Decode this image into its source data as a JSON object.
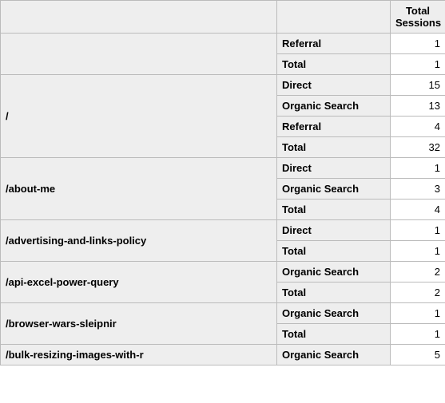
{
  "header": {
    "blank1": "",
    "blank2": "",
    "sessions_label": "Total Sessions"
  },
  "groups": [
    {
      "page": "",
      "rows": [
        {
          "channel": "Referral",
          "sessions": "1"
        },
        {
          "channel": "Total",
          "sessions": "1"
        }
      ]
    },
    {
      "page": "/",
      "rows": [
        {
          "channel": "Direct",
          "sessions": "15"
        },
        {
          "channel": "Organic Search",
          "sessions": "13"
        },
        {
          "channel": "Referral",
          "sessions": "4"
        },
        {
          "channel": "Total",
          "sessions": "32"
        }
      ]
    },
    {
      "page": "/about-me",
      "rows": [
        {
          "channel": "Direct",
          "sessions": "1"
        },
        {
          "channel": "Organic Search",
          "sessions": "3"
        },
        {
          "channel": "Total",
          "sessions": "4"
        }
      ]
    },
    {
      "page": "/advertising-and-links-policy",
      "rows": [
        {
          "channel": "Direct",
          "sessions": "1"
        },
        {
          "channel": "Total",
          "sessions": "1"
        }
      ]
    },
    {
      "page": "/api-excel-power-query",
      "rows": [
        {
          "channel": "Organic Search",
          "sessions": "2"
        },
        {
          "channel": "Total",
          "sessions": "2"
        }
      ]
    },
    {
      "page": "/browser-wars-sleipnir",
      "rows": [
        {
          "channel": "Organic Search",
          "sessions": "1"
        },
        {
          "channel": "Total",
          "sessions": "1"
        }
      ]
    },
    {
      "page": "/bulk-resizing-images-with-r",
      "rows": [
        {
          "channel": "Organic Search",
          "sessions": "5"
        }
      ]
    }
  ]
}
